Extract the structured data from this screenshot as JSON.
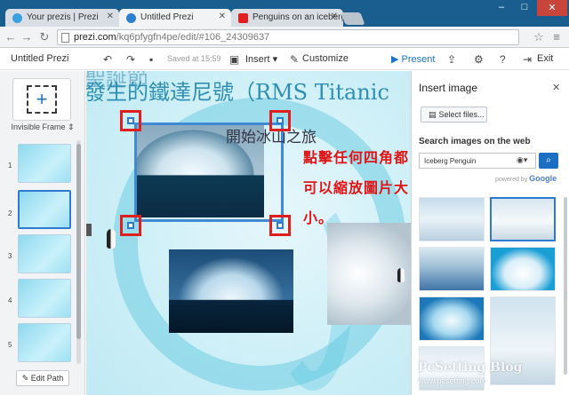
{
  "browser": {
    "tabs": [
      {
        "title": "Your prezis | Prezi",
        "favicon_color": "#3aa0e0"
      },
      {
        "title": "Untitled Prezi",
        "favicon_color": "#2d7fd0"
      },
      {
        "title": "Penguins on an iceberg",
        "favicon_color": "#e02020"
      }
    ],
    "url_host": "prezi.com",
    "url_path": "/kq6pfygfn4pe/edit/#106_24309637",
    "window_controls": {
      "minimize": "–",
      "maximize": "□",
      "close": "✕"
    }
  },
  "toolbar": {
    "doc_title": "Untitled Prezi",
    "saved_text": "Saved at 15:59",
    "insert_label": "Insert",
    "customize_label": "Customize",
    "present_label": "Present",
    "exit_label": "Exit"
  },
  "left_panel": {
    "frame_type": "Invisible Frame",
    "thumb_numbers": [
      "1",
      "2",
      "3",
      "4",
      "5"
    ],
    "edit_path_label": "Edit Path"
  },
  "canvas": {
    "title_line1": "發生的鐵達尼號（RMS Titanic",
    "title_line0": "聖誕節",
    "frame_caption": "開始冰山之旅",
    "instruction": [
      "點擊任何四角都",
      "可以縮放圖片大",
      "小。"
    ]
  },
  "insert_panel": {
    "title": "Insert image",
    "select_files": "Select files...",
    "search_label": "Search images on the web",
    "search_value": "Iceberg Penguin",
    "powered_by": "powered by",
    "google": "Google"
  },
  "watermark": {
    "line1": "PcSetting Blog",
    "line2": "www.pcsetting.com"
  },
  "colors": {
    "accent": "#2c7bd0",
    "instruction": "#e01414",
    "title": "#2f8fb3"
  }
}
